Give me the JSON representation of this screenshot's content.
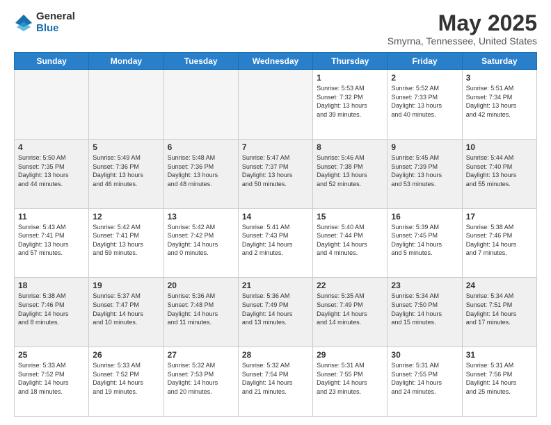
{
  "logo": {
    "general": "General",
    "blue": "Blue"
  },
  "header": {
    "title": "May 2025",
    "location": "Smyrna, Tennessee, United States"
  },
  "weekdays": [
    "Sunday",
    "Monday",
    "Tuesday",
    "Wednesday",
    "Thursday",
    "Friday",
    "Saturday"
  ],
  "weeks": [
    [
      {
        "day": "",
        "info": ""
      },
      {
        "day": "",
        "info": ""
      },
      {
        "day": "",
        "info": ""
      },
      {
        "day": "",
        "info": ""
      },
      {
        "day": "1",
        "info": "Sunrise: 5:53 AM\nSunset: 7:32 PM\nDaylight: 13 hours\nand 39 minutes."
      },
      {
        "day": "2",
        "info": "Sunrise: 5:52 AM\nSunset: 7:33 PM\nDaylight: 13 hours\nand 40 minutes."
      },
      {
        "day": "3",
        "info": "Sunrise: 5:51 AM\nSunset: 7:34 PM\nDaylight: 13 hours\nand 42 minutes."
      }
    ],
    [
      {
        "day": "4",
        "info": "Sunrise: 5:50 AM\nSunset: 7:35 PM\nDaylight: 13 hours\nand 44 minutes."
      },
      {
        "day": "5",
        "info": "Sunrise: 5:49 AM\nSunset: 7:36 PM\nDaylight: 13 hours\nand 46 minutes."
      },
      {
        "day": "6",
        "info": "Sunrise: 5:48 AM\nSunset: 7:36 PM\nDaylight: 13 hours\nand 48 minutes."
      },
      {
        "day": "7",
        "info": "Sunrise: 5:47 AM\nSunset: 7:37 PM\nDaylight: 13 hours\nand 50 minutes."
      },
      {
        "day": "8",
        "info": "Sunrise: 5:46 AM\nSunset: 7:38 PM\nDaylight: 13 hours\nand 52 minutes."
      },
      {
        "day": "9",
        "info": "Sunrise: 5:45 AM\nSunset: 7:39 PM\nDaylight: 13 hours\nand 53 minutes."
      },
      {
        "day": "10",
        "info": "Sunrise: 5:44 AM\nSunset: 7:40 PM\nDaylight: 13 hours\nand 55 minutes."
      }
    ],
    [
      {
        "day": "11",
        "info": "Sunrise: 5:43 AM\nSunset: 7:41 PM\nDaylight: 13 hours\nand 57 minutes."
      },
      {
        "day": "12",
        "info": "Sunrise: 5:42 AM\nSunset: 7:41 PM\nDaylight: 13 hours\nand 59 minutes."
      },
      {
        "day": "13",
        "info": "Sunrise: 5:42 AM\nSunset: 7:42 PM\nDaylight: 14 hours\nand 0 minutes."
      },
      {
        "day": "14",
        "info": "Sunrise: 5:41 AM\nSunset: 7:43 PM\nDaylight: 14 hours\nand 2 minutes."
      },
      {
        "day": "15",
        "info": "Sunrise: 5:40 AM\nSunset: 7:44 PM\nDaylight: 14 hours\nand 4 minutes."
      },
      {
        "day": "16",
        "info": "Sunrise: 5:39 AM\nSunset: 7:45 PM\nDaylight: 14 hours\nand 5 minutes."
      },
      {
        "day": "17",
        "info": "Sunrise: 5:38 AM\nSunset: 7:46 PM\nDaylight: 14 hours\nand 7 minutes."
      }
    ],
    [
      {
        "day": "18",
        "info": "Sunrise: 5:38 AM\nSunset: 7:46 PM\nDaylight: 14 hours\nand 8 minutes."
      },
      {
        "day": "19",
        "info": "Sunrise: 5:37 AM\nSunset: 7:47 PM\nDaylight: 14 hours\nand 10 minutes."
      },
      {
        "day": "20",
        "info": "Sunrise: 5:36 AM\nSunset: 7:48 PM\nDaylight: 14 hours\nand 11 minutes."
      },
      {
        "day": "21",
        "info": "Sunrise: 5:36 AM\nSunset: 7:49 PM\nDaylight: 14 hours\nand 13 minutes."
      },
      {
        "day": "22",
        "info": "Sunrise: 5:35 AM\nSunset: 7:49 PM\nDaylight: 14 hours\nand 14 minutes."
      },
      {
        "day": "23",
        "info": "Sunrise: 5:34 AM\nSunset: 7:50 PM\nDaylight: 14 hours\nand 15 minutes."
      },
      {
        "day": "24",
        "info": "Sunrise: 5:34 AM\nSunset: 7:51 PM\nDaylight: 14 hours\nand 17 minutes."
      }
    ],
    [
      {
        "day": "25",
        "info": "Sunrise: 5:33 AM\nSunset: 7:52 PM\nDaylight: 14 hours\nand 18 minutes."
      },
      {
        "day": "26",
        "info": "Sunrise: 5:33 AM\nSunset: 7:52 PM\nDaylight: 14 hours\nand 19 minutes."
      },
      {
        "day": "27",
        "info": "Sunrise: 5:32 AM\nSunset: 7:53 PM\nDaylight: 14 hours\nand 20 minutes."
      },
      {
        "day": "28",
        "info": "Sunrise: 5:32 AM\nSunset: 7:54 PM\nDaylight: 14 hours\nand 21 minutes."
      },
      {
        "day": "29",
        "info": "Sunrise: 5:31 AM\nSunset: 7:55 PM\nDaylight: 14 hours\nand 23 minutes."
      },
      {
        "day": "30",
        "info": "Sunrise: 5:31 AM\nSunset: 7:55 PM\nDaylight: 14 hours\nand 24 minutes."
      },
      {
        "day": "31",
        "info": "Sunrise: 5:31 AM\nSunset: 7:56 PM\nDaylight: 14 hours\nand 25 minutes."
      }
    ]
  ]
}
